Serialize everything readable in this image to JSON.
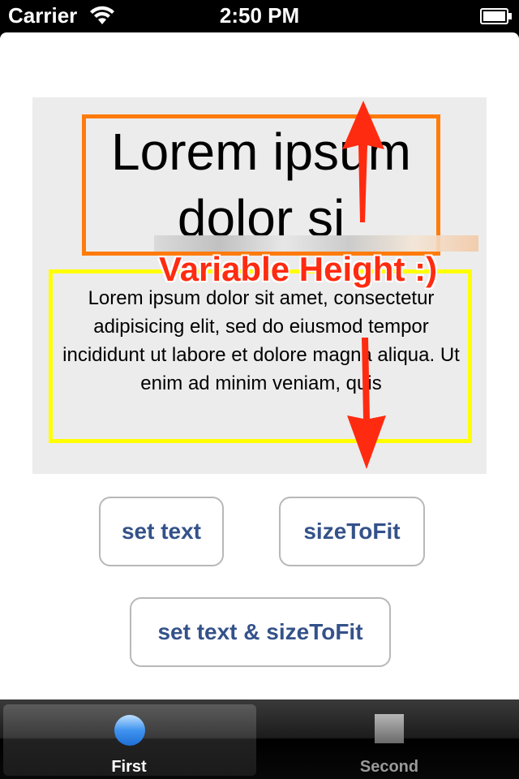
{
  "status_bar": {
    "carrier": "Carrier",
    "time": "2:50 PM"
  },
  "content": {
    "big_label": "Lorem ipsum dolor si",
    "small_label": "Lorem ipsum dolor sit amet, consectetur adipisicing elit, sed do eiusmod tempor incididunt ut labore et dolore magna aliqua. Ut enim ad minim veniam, quis",
    "annotation": "Variable Height :)"
  },
  "buttons": {
    "set_text": "set text",
    "size_to_fit": "sizeToFit",
    "set_text_and_size_to_fit": "set text & sizeToFit"
  },
  "tab_bar": {
    "tabs": [
      {
        "label": "First",
        "selected": true,
        "icon": "blue-circle-icon"
      },
      {
        "label": "Second",
        "selected": false,
        "icon": "gray-square-icon"
      }
    ]
  },
  "colors": {
    "orange_border": "#ff7b0c",
    "yellow_border": "#ffff00",
    "annotation": "#ff2b10",
    "button_text": "#34528a"
  }
}
